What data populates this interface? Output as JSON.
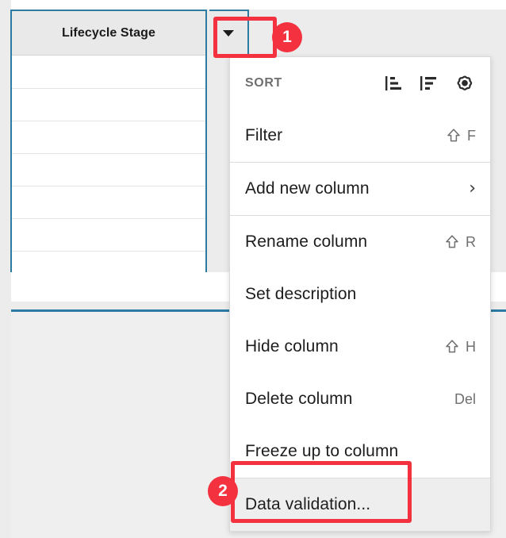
{
  "grid": {
    "column_header_label": "Lifecycle Stage",
    "dropdown_icon": "caret-down-icon",
    "row_count": 7
  },
  "menu": {
    "sections": [
      {
        "rows": [
          {
            "label": "SORT",
            "type": "section-title",
            "icons": [
              "sort-ascending-icon",
              "sort-descending-icon",
              "sort-settings-gear-icon"
            ]
          },
          {
            "label": "Filter",
            "type": "item",
            "shortcut_modifier": "⇧",
            "shortcut_key": "F"
          }
        ]
      },
      {
        "rows": [
          {
            "label": "Add new column",
            "type": "item",
            "submenu_icon": "chevron-right-icon"
          }
        ]
      },
      {
        "rows": [
          {
            "label": "Rename column",
            "type": "item",
            "shortcut_modifier": "⇧",
            "shortcut_key": "R"
          },
          {
            "label": "Set description",
            "type": "item"
          },
          {
            "label": "Hide column",
            "type": "item",
            "shortcut_modifier": "⇧",
            "shortcut_key": "H"
          },
          {
            "label": "Delete column",
            "type": "item",
            "shortcut_key": "Del"
          },
          {
            "label": "Freeze up to column",
            "type": "item"
          }
        ]
      },
      {
        "rows": [
          {
            "label": "Data validation...",
            "type": "item",
            "hovered": true
          }
        ]
      }
    ]
  },
  "annotations": [
    {
      "badge": "1",
      "target": "column-header-dropdown-button"
    },
    {
      "badge": "2",
      "target": "menu-item-data-validation"
    }
  ],
  "colors": {
    "accent_blue": "#2b7ba3",
    "annotation_red": "#f4313f",
    "header_gray": "#e9e9e9",
    "page_background": "#ececec",
    "menu_background": "#ffffff",
    "hover_background": "#eeeeee",
    "muted_text": "#6f6f6f",
    "primary_text": "#1d1d1d"
  }
}
